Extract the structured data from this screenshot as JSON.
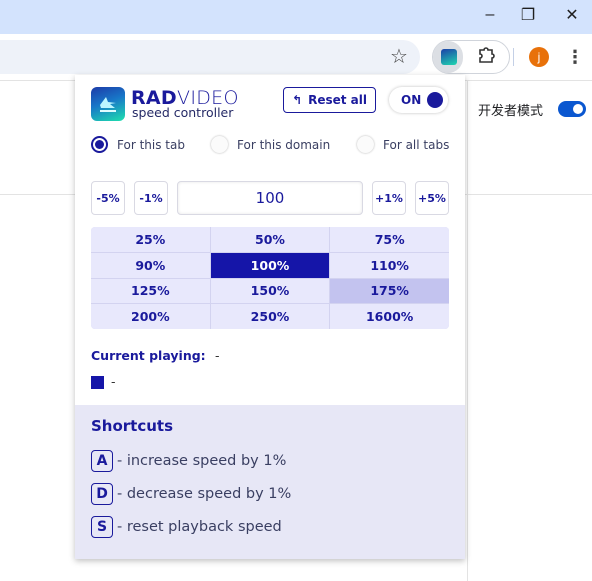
{
  "browser": {
    "window_controls": {
      "minimize": "–",
      "restore": "❐",
      "close": "✕"
    },
    "toolbar": {
      "bookmark_icon": "star-icon",
      "extension_icon": "radvideo-extension-icon",
      "extensions_icon": "puzzle-icon",
      "avatar_letter": "j",
      "menu_icon": "⋮"
    }
  },
  "page": {
    "developer_mode_label": "开发者模式",
    "developer_mode_on": true
  },
  "popup": {
    "brand": {
      "bold": "RAD",
      "light": "VIDEO",
      "subtitle": "speed controller"
    },
    "reset_all_label": "Reset all",
    "power_toggle_label": "ON",
    "scope_options": [
      {
        "label": "For this tab",
        "checked": true
      },
      {
        "label": "For this domain",
        "checked": false
      },
      {
        "label": "For all tabs",
        "checked": false
      }
    ],
    "steppers": {
      "minus5": "-5%",
      "minus1": "-1%",
      "plus1": "+1%",
      "plus5": "+5%"
    },
    "speed_value": "100",
    "presets": [
      {
        "label": "25%",
        "state": "normal"
      },
      {
        "label": "50%",
        "state": "normal"
      },
      {
        "label": "75%",
        "state": "normal"
      },
      {
        "label": "90%",
        "state": "normal"
      },
      {
        "label": "100%",
        "state": "active"
      },
      {
        "label": "110%",
        "state": "normal"
      },
      {
        "label": "125%",
        "state": "normal"
      },
      {
        "label": "150%",
        "state": "normal"
      },
      {
        "label": "175%",
        "state": "hover"
      },
      {
        "label": "200%",
        "state": "normal"
      },
      {
        "label": "250%",
        "state": "normal"
      },
      {
        "label": "1600%",
        "state": "normal"
      }
    ],
    "current_playing": {
      "label": "Current playing:",
      "value": "-",
      "media_value": "-"
    },
    "shortcuts": {
      "title": "Shortcuts",
      "items": [
        {
          "key": "A",
          "description": "- increase speed by 1%"
        },
        {
          "key": "D",
          "description": "- decrease speed by 1%"
        },
        {
          "key": "S",
          "description": "- reset playback speed"
        }
      ]
    },
    "colors": {
      "primary": "#1a1a9c",
      "active_cell": "#1515a8",
      "cell_bg": "#e8e8fc",
      "hover_cell": "#c3c3ef",
      "shortcuts_bg": "#e7e7f6"
    }
  }
}
